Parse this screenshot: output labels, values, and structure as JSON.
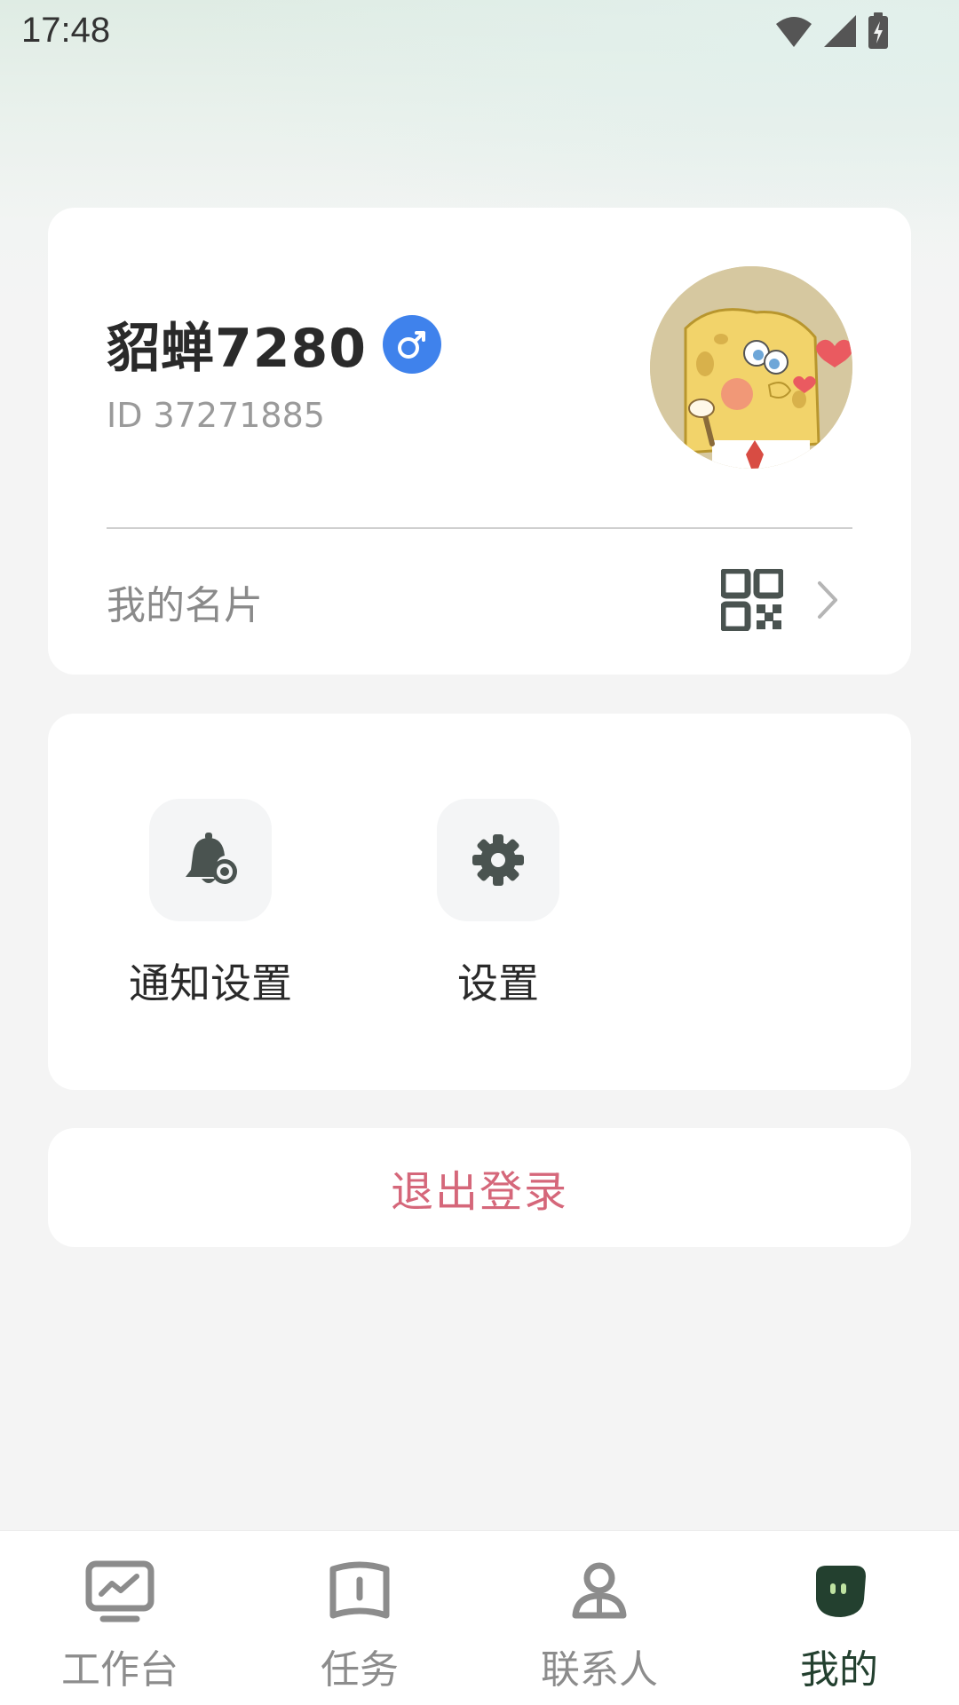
{
  "status_bar": {
    "time": "17:48"
  },
  "profile": {
    "name": "貂蝉7280",
    "gender_icon": "male-icon",
    "id_text": "ID 37271885",
    "card_row_label": "我的名片"
  },
  "menu": {
    "items": [
      {
        "label": "通知设置",
        "icon": "bell-gear-icon"
      },
      {
        "label": "设置",
        "icon": "gear-icon"
      }
    ]
  },
  "logout": {
    "label": "退出登录"
  },
  "bottom_nav": {
    "items": [
      {
        "label": "工作台",
        "icon": "monitor-chart-icon"
      },
      {
        "label": "任务",
        "icon": "book-icon"
      },
      {
        "label": "联系人",
        "icon": "person-icon"
      },
      {
        "label": "我的",
        "icon": "chat-face-icon"
      }
    ],
    "active": "我的"
  },
  "colors": {
    "accent_blue": "#3f82ec",
    "logout_red": "#d5677a",
    "active_nav": "#23402f",
    "icon_dark": "#4a5350"
  }
}
